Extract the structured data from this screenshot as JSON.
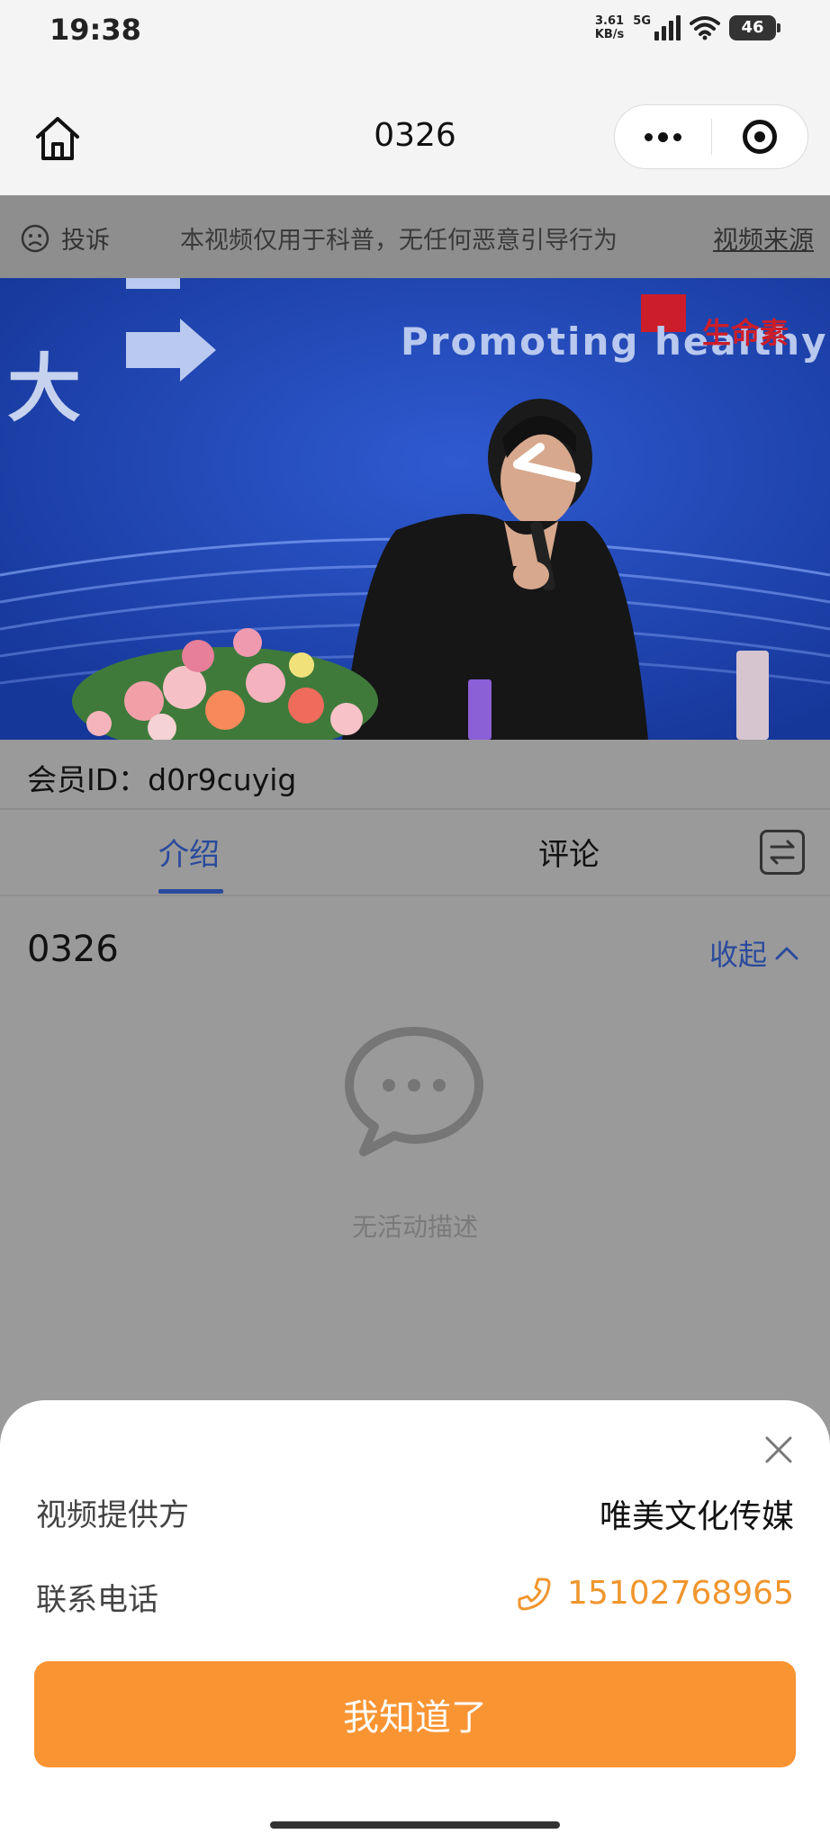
{
  "status_bar": {
    "time": "19:38",
    "net_speed_value": "3.61",
    "net_speed_unit": "KB/s",
    "network": "5G",
    "battery": "46"
  },
  "nav": {
    "title": "0326",
    "home_icon": "home-icon",
    "more_icon": "more-icon",
    "close_icon": "target-icon"
  },
  "notice": {
    "complain_label": "投诉",
    "marquee_text": "本视频仅用于科普，无任何恶意引导行为",
    "source_link": "视频来源"
  },
  "video": {
    "slogan": "Promoting healthy C",
    "big_char": "大",
    "brand": "生命素"
  },
  "member": {
    "label": "会员ID：d0r9cuyig"
  },
  "tabs": {
    "intro": "介绍",
    "comment": "评论"
  },
  "intro": {
    "title": "0326",
    "collapse_label": "收起",
    "empty_text": "无活动描述"
  },
  "sheet": {
    "provider_label": "视频提供方",
    "provider_value": "唯美文化传媒",
    "phone_label": "联系电话",
    "phone_value": "15102768965",
    "confirm_label": "我知道了"
  },
  "colors": {
    "accent_blue": "#2a4a9c",
    "accent_orange": "#f99433",
    "phone_orange": "#f0962e",
    "overlay_gray": "#9a9a9a"
  }
}
